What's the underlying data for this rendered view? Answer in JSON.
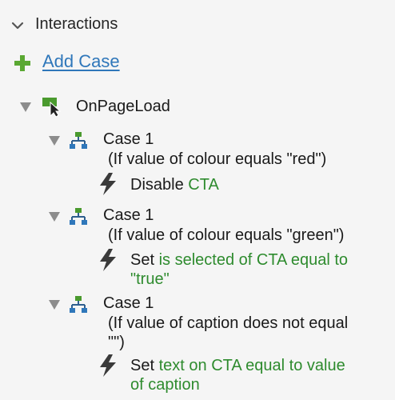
{
  "panel": {
    "title": "Interactions",
    "add_case_label": "Add Case"
  },
  "event": {
    "name": "OnPageLoad"
  },
  "cases": [
    {
      "label": "Case 1",
      "condition_line1": "(If value of colour equals \"red\")",
      "condition_line2": "",
      "action_verb": "Disable",
      "action_line1": "CTA",
      "action_line2": ""
    },
    {
      "label": "Case 1",
      "condition_line1": "(If value of colour equals \"green\")",
      "condition_line2": "",
      "action_verb": "Set",
      "action_line1": "is selected of CTA equal to",
      "action_line2": "\"true\""
    },
    {
      "label": "Case 1",
      "condition_line1": "(If value of caption does not equal",
      "condition_line2": "\"\")",
      "action_verb": "Set",
      "action_line1": "text on CTA equal to value",
      "action_line2": "of caption"
    }
  ],
  "colors": {
    "link": "#2f77ba",
    "action_target": "#2e8b2e",
    "plus": "#5aa832",
    "background": "#f5f5f5"
  },
  "icons": [
    "chevron-down-icon",
    "plus-icon",
    "triangle-down-icon",
    "event-cursor-icon",
    "case-tree-icon",
    "lightning-icon"
  ]
}
